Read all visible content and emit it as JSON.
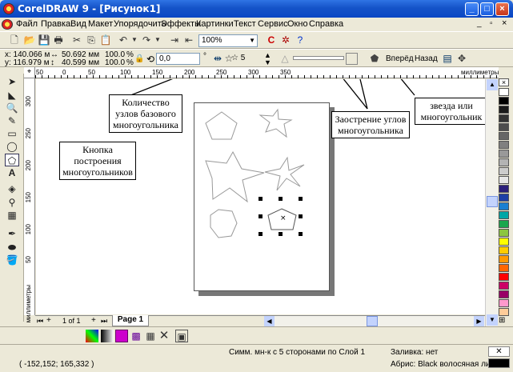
{
  "window": {
    "title": "CorelDRAW 9 - [Рисунок1]",
    "minimize": "_",
    "maximize": "□",
    "close": "×"
  },
  "menu": [
    "Файл",
    "Правка",
    "Вид",
    "Макет",
    "Упорядочить",
    "Эффекты",
    "Картинки",
    "Текст",
    "Сервис",
    "Окно",
    "Справка"
  ],
  "standard_toolbar": {
    "zoom_value": "100%"
  },
  "property_bar": {
    "x_pos": "x: 140.066 м",
    "y_pos": "y: 116.979 м",
    "width": "50.692 мм",
    "height": "40.599 мм",
    "scale_x": "100.0",
    "scale_y": "100.0",
    "scale_unit": "%",
    "rotation": "0,0",
    "rotation_unit": "°",
    "points_count": "5",
    "forward_label": "Вперёд",
    "back_label": "Назад"
  },
  "ruler": {
    "h_ticks": [
      "50",
      "0",
      "50",
      "100",
      "150",
      "200",
      "250",
      "300",
      "350"
    ],
    "h_unit": "миллиметры",
    "v_ticks": [
      "300",
      "250",
      "200",
      "150",
      "100",
      "50",
      "0"
    ],
    "v_unit": "миллиметры"
  },
  "palette_colors": [
    "#ffffff",
    "#000000",
    "#1a1a1a",
    "#333333",
    "#4d4d4d",
    "#666666",
    "#808080",
    "#999999",
    "#b3b3b3",
    "#cccccc",
    "#e6e6e6",
    "#2b1e7a",
    "#1e3fa6",
    "#1a7fd1",
    "#00a6a6",
    "#1aa64d",
    "#8cc63f",
    "#ffff00",
    "#ffcc00",
    "#ff9900",
    "#ff6600",
    "#ff0000",
    "#cc0066",
    "#990066",
    "#ff99cc",
    "#ffcc99"
  ],
  "page_tab": {
    "counter": "1 of 1",
    "label": "Page 1"
  },
  "status": {
    "coords": "( -152,152; 165,332 )",
    "description": "Симм. мн-к с 5 сторонами по Слой 1",
    "fill": "Заливка: нет",
    "outline": "Абрис: Black  волосяная линия"
  },
  "callouts": {
    "points_count": "Количество узлов базового многоугольника",
    "polygon_tool": "Кнопка построения многоугольников",
    "sharpness": "Заострение углов многоугольника",
    "star_or_polygon": "звезда или многоугольник"
  }
}
